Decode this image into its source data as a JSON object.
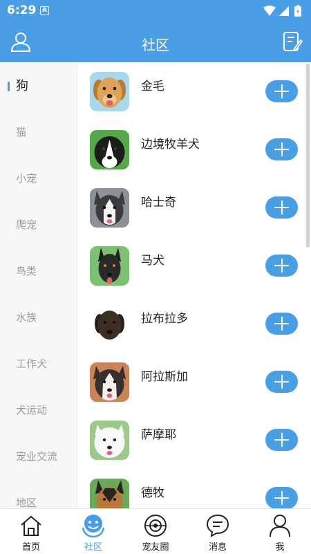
{
  "status_bar": {
    "time": "6:29",
    "notification_letter": "A"
  },
  "header": {
    "title": "社区",
    "left_icon": "user-icon",
    "right_icon": "edit-note-icon"
  },
  "sidebar": {
    "items": [
      {
        "label": "狗",
        "active": true
      },
      {
        "label": "猫",
        "active": false
      },
      {
        "label": "小宠",
        "active": false
      },
      {
        "label": "爬宠",
        "active": false
      },
      {
        "label": "鸟类",
        "active": false
      },
      {
        "label": "水族",
        "active": false
      },
      {
        "label": "工作犬",
        "active": false
      },
      {
        "label": "犬运动",
        "active": false
      },
      {
        "label": "宠业交流",
        "active": false
      },
      {
        "label": "地区",
        "active": false
      }
    ]
  },
  "breeds": [
    {
      "name": "金毛",
      "icon": "golden-retriever-photo"
    },
    {
      "name": "边境牧羊犬",
      "icon": "border-collie-photo"
    },
    {
      "name": "哈士奇",
      "icon": "husky-photo"
    },
    {
      "name": "马犬",
      "icon": "malinois-photo"
    },
    {
      "name": "拉布拉多",
      "icon": "labrador-photo"
    },
    {
      "name": "阿拉斯加",
      "icon": "malamute-photo"
    },
    {
      "name": "萨摩耶",
      "icon": "samoyed-photo"
    },
    {
      "name": "德牧",
      "icon": "german-shepherd-photo"
    }
  ],
  "tabbar": {
    "tabs": [
      {
        "label": "首页",
        "icon": "home-icon",
        "active": false
      },
      {
        "label": "社区",
        "icon": "community-icon",
        "active": true
      },
      {
        "label": "宠友圈",
        "icon": "pet-circle-icon",
        "active": false
      },
      {
        "label": "消息",
        "icon": "message-icon",
        "active": false
      },
      {
        "label": "我",
        "icon": "profile-icon",
        "active": false
      }
    ]
  },
  "colors": {
    "primary": "#4a9ee6",
    "sidebar_bg": "#f7f7f7",
    "text_muted": "#9a9a9a"
  }
}
